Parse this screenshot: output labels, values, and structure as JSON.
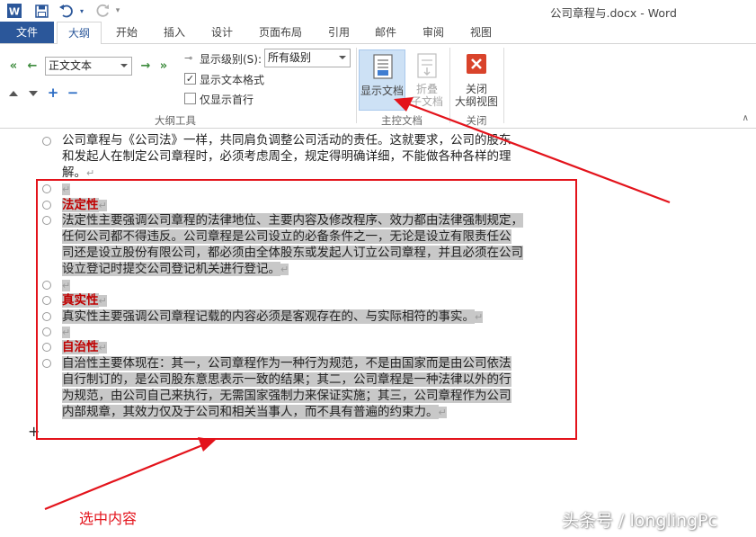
{
  "window": {
    "title": "公司章程与.docx - Word"
  },
  "tabs": [
    "文件",
    "大纲",
    "开始",
    "插入",
    "设计",
    "页面布局",
    "引用",
    "邮件",
    "审阅",
    "视图"
  ],
  "active_tab": "大纲",
  "ribbon": {
    "outline_tools": {
      "level_value": "正文文本",
      "show_level_label": "显示级别(S):",
      "show_level_value": "所有级别",
      "show_text_format_label": "显示文本格式",
      "show_text_format_checked": true,
      "show_first_line_label": "仅显示首行",
      "show_first_line_checked": false,
      "group_label": "大纲工具"
    },
    "master_doc": {
      "show_doc_label": "显示文档",
      "collapse_label_1": "折叠",
      "collapse_label_2": "子文档",
      "group_label": "主控文档"
    },
    "close": {
      "label_1": "关闭",
      "label_2": "大纲视图",
      "group_label": "关闭"
    }
  },
  "document": {
    "intro": [
      "公司章程与《公司法》一样，共同肩负调整公司活动的责任。这就要求，公司的股东",
      "和发起人在制定公司章程时，必须考虑周全，规定得明确详细，不能做各种各样的理",
      "解。"
    ],
    "h1": "法定性",
    "p1": [
      "法定性主要强调公司章程的法律地位、主要内容及修改程序、效力都由法律强制规定，",
      "任何公司都不得违反。公司章程是公司设立的必备条件之一，无论是设立有限责任公",
      "司还是设立股份有限公司，都必须由全体股东或发起人订立公司章程，并且必须在公司",
      "设立登记时提交公司登记机关进行登记。"
    ],
    "h2": "真实性",
    "p2": "真实性主要强调公司章程记载的内容必须是客观存在的、与实际相符的事实。",
    "h3": "自治性",
    "p3": [
      "自治性主要体现在：其一，公司章程作为一种行为规范，不是由国家而是由公司依法",
      "自行制订的，是公司股东意思表示一致的结果；其二，公司章程是一种法律以外的行",
      "为规范，由公司自己来执行，无需国家强制力来保证实施；其三，公司章程作为公司",
      "内部规章，其效力仅及于公司和相关当事人，而不具有普遍的约束力。"
    ]
  },
  "annotation": "选中内容",
  "watermark": "头条号 / longlingPc",
  "colors": {
    "accent": "#2b579a",
    "annotation_red": "#e3131b",
    "heading_red": "#c00000",
    "selection_gray": "#c8c8c8"
  },
  "icons": [
    "word-icon",
    "save-icon",
    "undo-icon",
    "redo-icon",
    "promote-to-heading-icon",
    "promote-icon",
    "demote-icon",
    "demote-to-body-icon",
    "move-up-icon",
    "move-down-icon",
    "expand-icon",
    "collapse-icon",
    "show-document-icon",
    "collapse-subdocuments-icon",
    "close-outline-view-icon"
  ]
}
